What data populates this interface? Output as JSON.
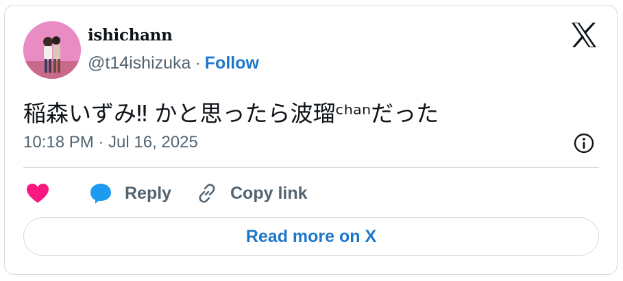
{
  "author": {
    "display_name": "ishichann",
    "handle": "@t14ishizuka",
    "separator": "·",
    "follow_label": "Follow"
  },
  "tweet": {
    "text": "稲森いずみ‼︎ かと思ったら波瑠ᶜʰᵃⁿだった",
    "timestamp": "10:18 PM · Jul 16, 2025"
  },
  "actions": {
    "reply_label": "Reply",
    "copy_link_label": "Copy link",
    "read_more_label": "Read more on X"
  },
  "icons": [
    "x-logo-icon",
    "info-icon",
    "heart-icon",
    "reply-bubble-icon",
    "link-icon"
  ],
  "colors": {
    "accent": "#1d77c9",
    "heart": "#f91880",
    "reply_bubble": "#1d9bf0",
    "muted": "#536471",
    "border": "#cfd9de"
  }
}
